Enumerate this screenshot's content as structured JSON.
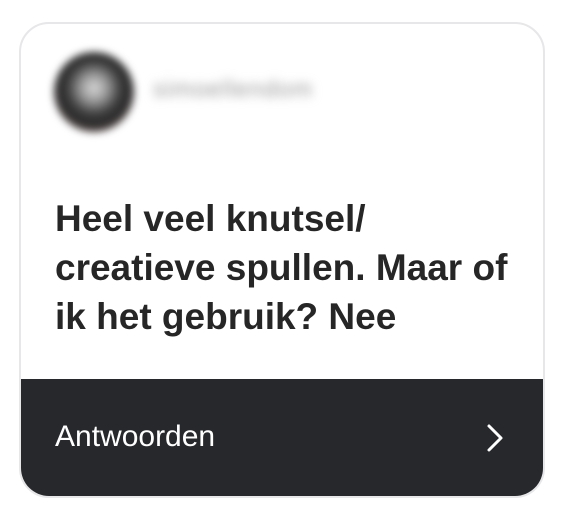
{
  "profile": {
    "username": "simoellendom"
  },
  "question": {
    "text": "Heel veel knutsel/ creatieve spullen. Maar of ik het gebruik? Nee"
  },
  "footer": {
    "label": "Antwoorden",
    "icon": "chevron-right-icon"
  },
  "colors": {
    "footer_bg": "#26282c",
    "text_dark": "#262626",
    "border": "#e7e7e9"
  }
}
